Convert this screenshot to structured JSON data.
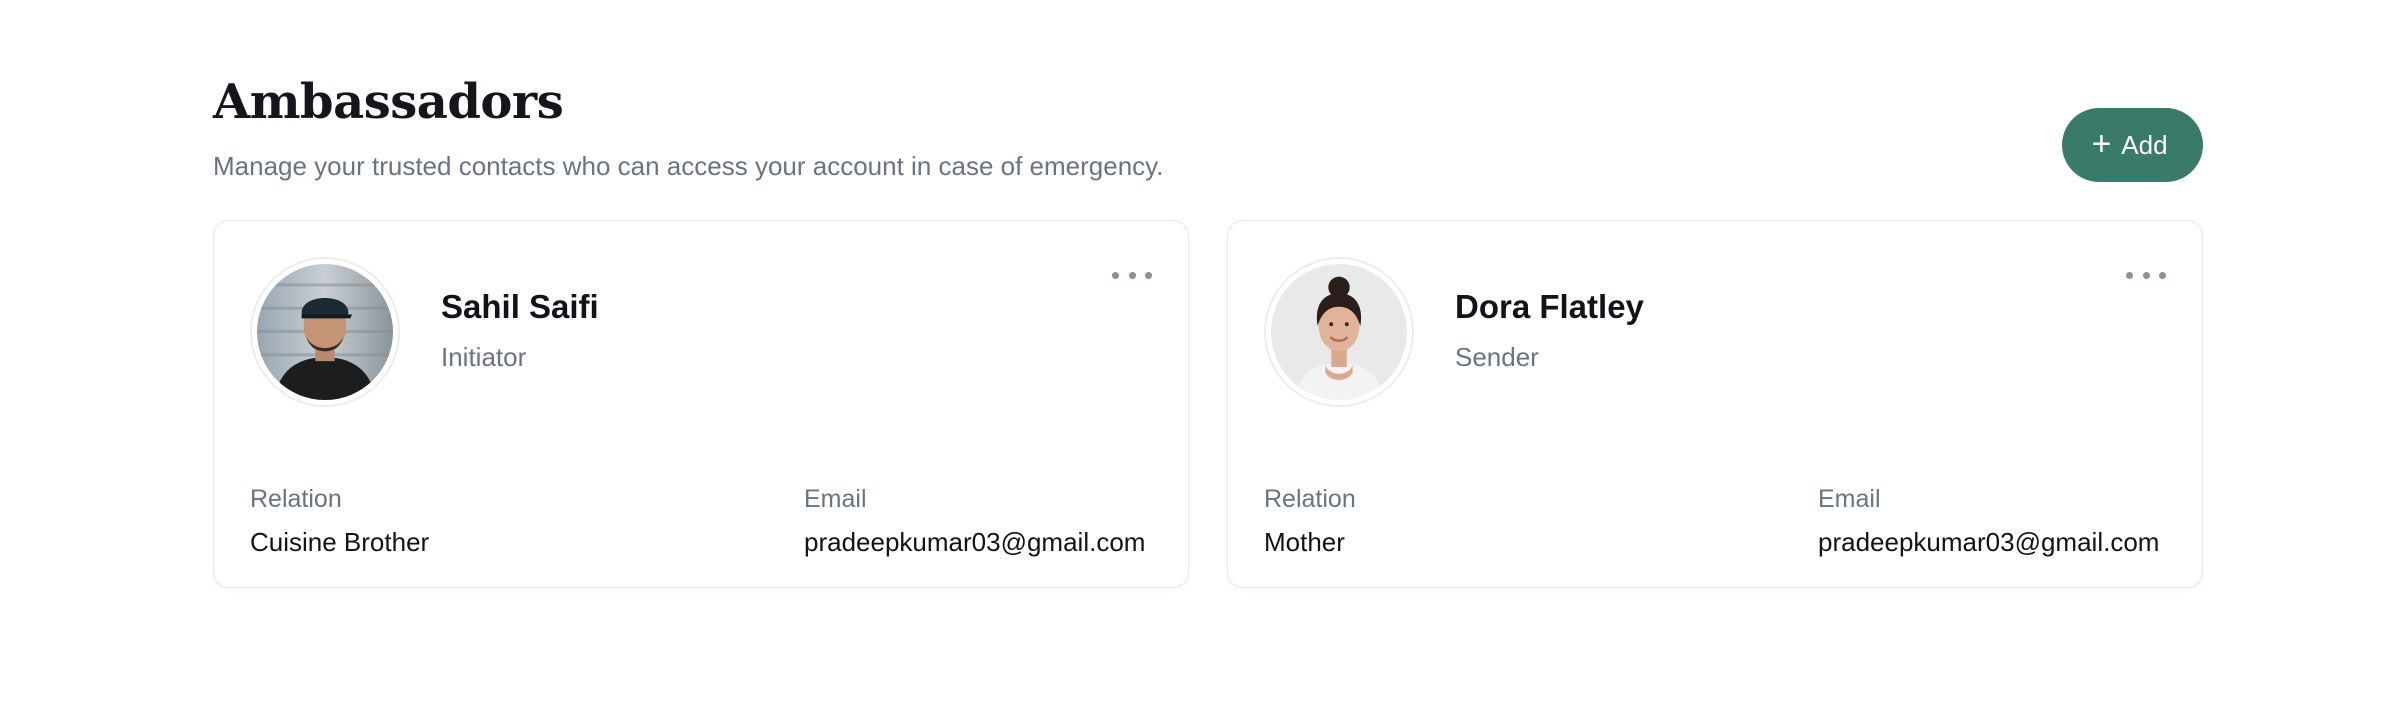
{
  "header": {
    "title": "Ambassadors",
    "subtitle": "Manage your trusted contacts who can access your account in case of emergency.",
    "add_label": "Add",
    "add_icon": "plus-icon"
  },
  "theme": {
    "accent": "#3a7a68",
    "muted_text": "#6b7280",
    "card_border": "#e5e7eb"
  },
  "ambassadors": [
    {
      "name": "Sahil Saifi",
      "role": "Initiator",
      "relation_label": "Relation",
      "relation": "Cuisine Brother",
      "email_label": "Email",
      "email": "pradeepkumar03@gmail.com",
      "menu_icon": "more-horizontal-icon",
      "avatar": "avatar-photo-man"
    },
    {
      "name": "Dora Flatley",
      "role": "Sender",
      "relation_label": "Relation",
      "relation": "Mother",
      "email_label": "Email",
      "email": "pradeepkumar03@gmail.com",
      "menu_icon": "more-horizontal-icon",
      "avatar": "avatar-photo-woman"
    }
  ]
}
